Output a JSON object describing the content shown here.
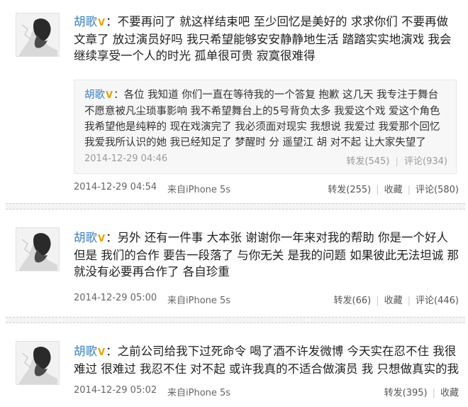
{
  "posts": [
    {
      "author": "胡歌",
      "badge": "V",
      "text": "不要再问了 就这样结束吧 至少回忆是美好的 求求你们 不要再做文章了 放过演员好吗 我只希望能够安安静静地生活 踏踏实实地演戏 我会继续享受一个人的时光 孤单很可贵 寂寞很难得",
      "quote": {
        "author": "胡歌",
        "badge": "V",
        "text": "各位 我知道 你们一直在等待我的一个答复 抱歉 这几天 我专注于舞台 不愿意被凡尘琐事影响 我不希望舞台上的5号背负太多 我爱这个戏 爱这个角色 我希望他是纯粹的 现在戏演完了 我必须面对现实 我想说 我爱过 我爱那个回忆 我爱我所认识的她 我已经知足了 梦醒时 分 遥望江 胡 对不起 让大家失望了",
        "time": "2014-12-29 04:46",
        "repost": "转发(545)",
        "comment": "评论(934)"
      },
      "time": "2014-12-29 04:54",
      "source": "来自iPhone 5s",
      "repost": "转发(255)",
      "fav": "收藏",
      "comment": "评论(580)"
    },
    {
      "author": "胡歌",
      "badge": "V",
      "text": "另外 还有一件事 大本张 谢谢你一年来对我的帮助 你是一个好人 但是 我们的合作 要告一段落了 与你无关 是我的问题 如果彼此无法坦诚 那就没有必要再合作了 各自珍重",
      "time": "2014-12-29 05:00",
      "source": "来自iPhone 5s",
      "repost": "转发(66)",
      "fav": "收藏",
      "comment": "评论(446)"
    },
    {
      "author": "胡歌",
      "badge": "V",
      "text": "之前公司给我下过死命令 喝了酒不许发微博 今天实在忍不住 我很难过 很难过 我忍不住 对不起 或许我真的不适合做演员 我 只想做真实的我",
      "time": "2014-12-29 05:02",
      "source": "来自iPhone 5s",
      "repost": "转发(395)",
      "fav": "收藏"
    }
  ],
  "colors": {
    "author_link": "#3a7fbf",
    "verified_badge": "#e8a300",
    "meta_text": "#666666"
  },
  "icons": {
    "avatar": "avatar-silhouette-icon"
  }
}
